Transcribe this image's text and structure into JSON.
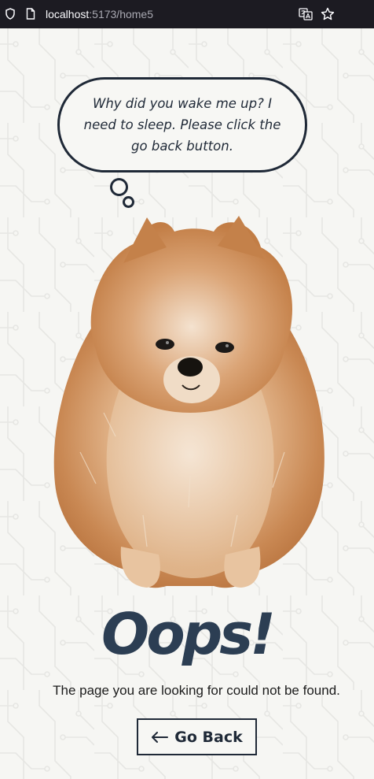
{
  "browser": {
    "url_host": "localhost",
    "url_path": ":5173/home5",
    "icons": [
      "shield-icon",
      "page-icon",
      "translate-icon",
      "star-icon"
    ]
  },
  "bubble": {
    "text": "Why did you wake me up? I need to sleep. Please click the go back button."
  },
  "main": {
    "title": "Oops!",
    "message": "The page you are looking for could not be found.",
    "button_label": "Go Back",
    "button_icon": "arrow-left-icon"
  },
  "colors": {
    "heading": "#2c3e53",
    "outline": "#1f2937",
    "background": "#f6f6f3"
  }
}
